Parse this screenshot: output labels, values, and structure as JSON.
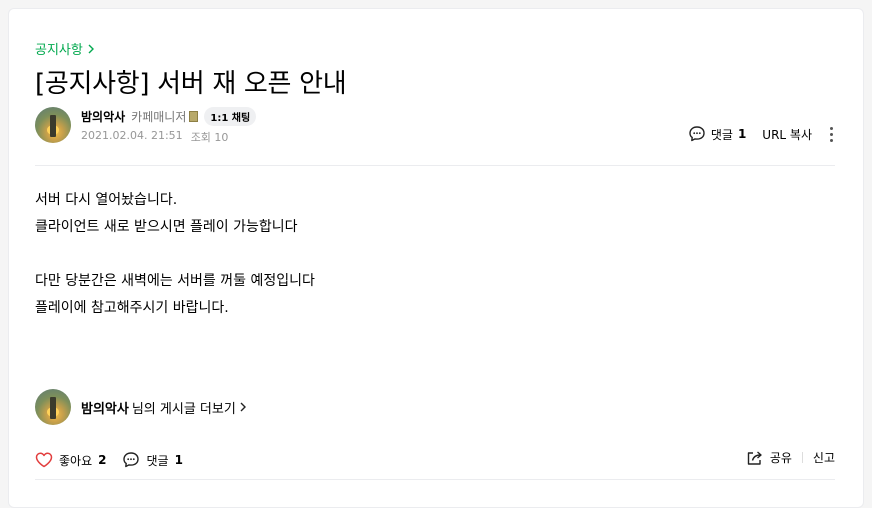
{
  "breadcrumb": {
    "label": "공지사항"
  },
  "article": {
    "title": "[공지사항] 서버 재 오픈 안내"
  },
  "author": {
    "nickname": "밤의악사",
    "role": "카페매니저",
    "chat_button": "1:1 채팅",
    "date": "2021.02.04. 21:51",
    "views": "조회 10"
  },
  "meta": {
    "comment_label": "댓글",
    "comment_count": "1",
    "url_copy": "URL 복사"
  },
  "body": {
    "lines": [
      "서버 다시 열어놨습니다.",
      "클라이언트 새로 받으시면 플레이 가능합니다",
      "",
      "다만 당분간은 새벽에는 서버를 꺼둘 예정입니다",
      "플레이에 참고해주시기 바랍니다."
    ]
  },
  "profile_link": {
    "nickname": "밤의악사",
    "suffix": "님의 게시글 더보기"
  },
  "actions": {
    "like_label": "좋아요",
    "like_count": "2",
    "comment_label": "댓글",
    "comment_count": "1",
    "share_label": "공유",
    "report_label": "신고"
  },
  "colors": {
    "accent": "#03a94f",
    "heart": "#e23e3e"
  }
}
